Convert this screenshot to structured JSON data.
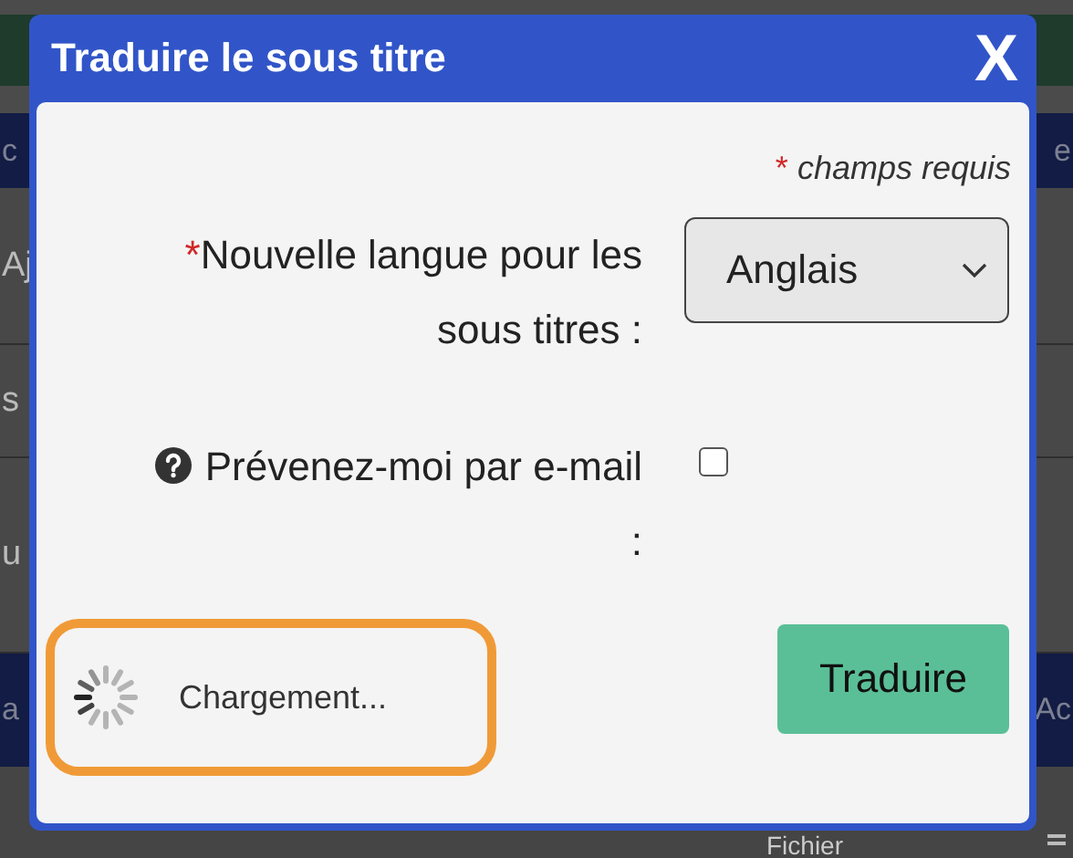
{
  "background": {
    "rows": [
      {
        "kind": "bar",
        "left": "c",
        "right": "e"
      },
      {
        "kind": "plain",
        "left": "Aj"
      },
      {
        "kind": "plain",
        "left": "s"
      },
      {
        "kind": "plain",
        "left": "u"
      },
      {
        "kind": "bar",
        "left": "a",
        "right": "Ac"
      },
      {
        "kind": "cells",
        "middle": "Fichier"
      }
    ]
  },
  "dialog": {
    "title": "Traduire le sous titre",
    "close": "X",
    "required_mark": "*",
    "required_note": "champs requis",
    "fields": [
      {
        "kind": "select",
        "required": true,
        "label": "Nouvelle langue pour les sous titres :",
        "value": "Anglais"
      },
      {
        "kind": "checkbox",
        "help": true,
        "label": "Prévenez-moi par e-mail :",
        "checked": false
      }
    ],
    "loading": {
      "text": "Chargement..."
    },
    "submit": "Traduire"
  }
}
